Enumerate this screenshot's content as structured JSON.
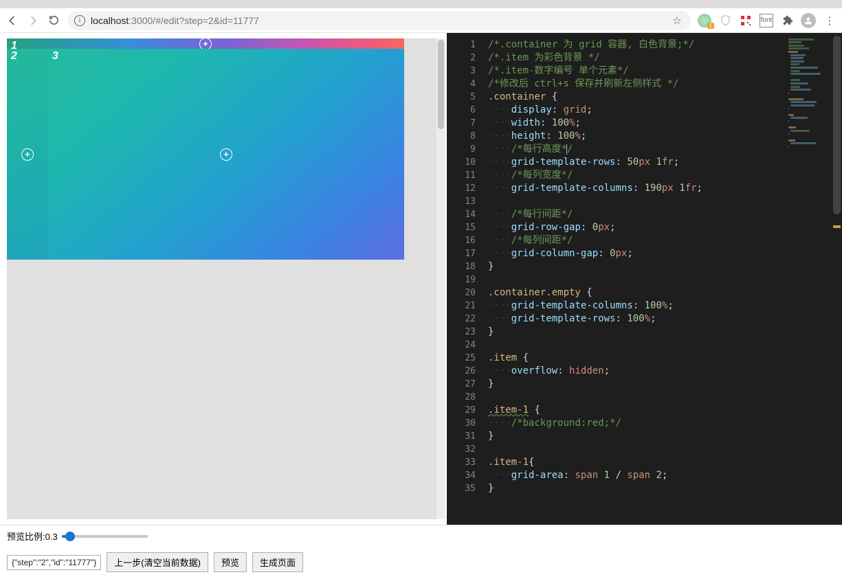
{
  "browser": {
    "url_host": "localhost",
    "url_port_path": ":3000/#/edit?step=2&id=11777",
    "extension_badge": "1",
    "font_ext_label": "font"
  },
  "preview": {
    "cells": {
      "c1": "1",
      "c2": "2",
      "c3": "3"
    }
  },
  "editor": {
    "lines": [
      {
        "n": 1,
        "segs": [
          [
            "cm",
            "/*.container 为 grid 容器, 白色背景;*/"
          ]
        ]
      },
      {
        "n": 2,
        "segs": [
          [
            "cm",
            "/*.item 为彩色背景 */"
          ]
        ]
      },
      {
        "n": 3,
        "segs": [
          [
            "cm",
            "/*.item-数字编号 单个元素*/"
          ]
        ]
      },
      {
        "n": 4,
        "segs": [
          [
            "cm",
            "/*修改后 ctrl+s 保存并刷新左侧样式 */"
          ]
        ]
      },
      {
        "n": 5,
        "segs": [
          [
            "sel",
            ".container"
          ],
          [
            "punc",
            " {"
          ]
        ]
      },
      {
        "n": 6,
        "indent": 1,
        "segs": [
          [
            "prop",
            "display"
          ],
          [
            "punc",
            ": "
          ],
          [
            "unit",
            "grid"
          ],
          [
            "punc",
            ";"
          ]
        ]
      },
      {
        "n": 7,
        "indent": 1,
        "segs": [
          [
            "prop",
            "width"
          ],
          [
            "punc",
            ": "
          ],
          [
            "num",
            "100"
          ],
          [
            "unit",
            "%"
          ],
          [
            "punc",
            ";"
          ]
        ]
      },
      {
        "n": 8,
        "indent": 1,
        "segs": [
          [
            "prop",
            "height"
          ],
          [
            "punc",
            ": "
          ],
          [
            "num",
            "100"
          ],
          [
            "unit",
            "%"
          ],
          [
            "punc",
            ";"
          ]
        ]
      },
      {
        "n": 9,
        "indent": 1,
        "segs": [
          [
            "cm",
            "/*每行高度*"
          ]
        ],
        "cursor": true,
        "cursorAfter": "/",
        "tail": [
          [
            "cm",
            "/"
          ]
        ]
      },
      {
        "n": 10,
        "indent": 1,
        "segs": [
          [
            "prop",
            "grid-template-rows"
          ],
          [
            "punc",
            ": "
          ],
          [
            "num",
            "50"
          ],
          [
            "unit",
            "px"
          ],
          [
            "punc",
            " "
          ],
          [
            "num",
            "1"
          ],
          [
            "unit",
            "fr"
          ],
          [
            "punc",
            ";"
          ]
        ]
      },
      {
        "n": 11,
        "indent": 1,
        "segs": [
          [
            "cm",
            "/*每列宽度*/"
          ]
        ]
      },
      {
        "n": 12,
        "indent": 1,
        "segs": [
          [
            "prop",
            "grid-template-columns"
          ],
          [
            "punc",
            ": "
          ],
          [
            "num",
            "190"
          ],
          [
            "unit",
            "px"
          ],
          [
            "punc",
            " "
          ],
          [
            "num",
            "1"
          ],
          [
            "unit",
            "fr"
          ],
          [
            "punc",
            ";"
          ]
        ]
      },
      {
        "n": 13,
        "indent": 0,
        "segs": []
      },
      {
        "n": 14,
        "indent": 1,
        "segs": [
          [
            "cm",
            "/*每行间距*/"
          ]
        ]
      },
      {
        "n": 15,
        "indent": 1,
        "segs": [
          [
            "prop",
            "grid-row-gap"
          ],
          [
            "punc",
            ": "
          ],
          [
            "num",
            "0"
          ],
          [
            "unit",
            "px"
          ],
          [
            "punc",
            ";"
          ]
        ]
      },
      {
        "n": 16,
        "indent": 1,
        "segs": [
          [
            "cm",
            "/*每列间距*/"
          ]
        ]
      },
      {
        "n": 17,
        "indent": 1,
        "segs": [
          [
            "prop",
            "grid-column-gap"
          ],
          [
            "punc",
            ": "
          ],
          [
            "num",
            "0"
          ],
          [
            "unit",
            "px"
          ],
          [
            "punc",
            ";"
          ]
        ]
      },
      {
        "n": 18,
        "segs": [
          [
            "punc",
            "}"
          ]
        ]
      },
      {
        "n": 19,
        "segs": []
      },
      {
        "n": 20,
        "segs": [
          [
            "sel",
            ".container.empty"
          ],
          [
            "punc",
            " {"
          ]
        ]
      },
      {
        "n": 21,
        "indent": 1,
        "segs": [
          [
            "prop",
            "grid-template-columns"
          ],
          [
            "punc",
            ": "
          ],
          [
            "num",
            "100"
          ],
          [
            "unit",
            "%"
          ],
          [
            "punc",
            ";"
          ]
        ]
      },
      {
        "n": 22,
        "indent": 1,
        "segs": [
          [
            "prop",
            "grid-template-rows"
          ],
          [
            "punc",
            ": "
          ],
          [
            "num",
            "100"
          ],
          [
            "unit",
            "%"
          ],
          [
            "punc",
            ";"
          ]
        ]
      },
      {
        "n": 23,
        "segs": [
          [
            "punc",
            "}"
          ]
        ]
      },
      {
        "n": 24,
        "segs": []
      },
      {
        "n": 25,
        "segs": [
          [
            "sel",
            ".item"
          ],
          [
            "punc",
            " {"
          ]
        ]
      },
      {
        "n": 26,
        "indent": 1,
        "segs": [
          [
            "prop",
            "overflow"
          ],
          [
            "punc",
            ": "
          ],
          [
            "unit",
            "hidden"
          ],
          [
            "punc",
            ";"
          ]
        ]
      },
      {
        "n": 27,
        "segs": [
          [
            "punc",
            "}"
          ]
        ]
      },
      {
        "n": 28,
        "segs": []
      },
      {
        "n": 29,
        "segs": [
          [
            "sel",
            ".item-1",
            "underline"
          ],
          [
            "punc",
            " {"
          ]
        ]
      },
      {
        "n": 30,
        "indent": 1,
        "segs": [
          [
            "cm",
            "/*background:red;*/"
          ]
        ]
      },
      {
        "n": 31,
        "segs": [
          [
            "punc",
            "}"
          ]
        ]
      },
      {
        "n": 32,
        "segs": []
      },
      {
        "n": 33,
        "segs": [
          [
            "sel",
            ".item-1"
          ],
          [
            "punc",
            "{"
          ]
        ]
      },
      {
        "n": 34,
        "indent": 1,
        "segs": [
          [
            "prop",
            "grid-area"
          ],
          [
            "punc",
            ": "
          ],
          [
            "unit",
            "span"
          ],
          [
            "punc",
            " "
          ],
          [
            "num",
            "1"
          ],
          [
            "punc",
            " / "
          ],
          [
            "unit",
            "span"
          ],
          [
            "punc",
            " "
          ],
          [
            "num",
            "2"
          ],
          [
            "punc",
            ";"
          ]
        ]
      },
      {
        "n": 35,
        "segs": [
          [
            "punc",
            "}"
          ]
        ]
      }
    ]
  },
  "footer": {
    "ratio_label": "预览比例:",
    "ratio_value": "0.3",
    "state_json": "{\"step\":\"2\",\"id\":\"11777\"}",
    "btn_prev": "上一步(清空当前数据)",
    "btn_preview": "预览",
    "btn_generate": "生成页面"
  }
}
